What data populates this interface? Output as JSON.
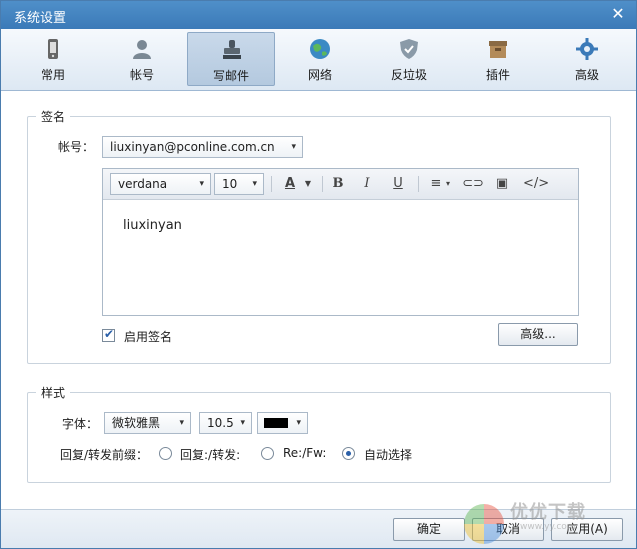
{
  "window": {
    "title": "系统设置"
  },
  "tabs": [
    {
      "label": "常用",
      "icon": "phone-icon"
    },
    {
      "label": "帐号",
      "icon": "user-icon"
    },
    {
      "label": "写邮件",
      "icon": "stamp-icon",
      "active": true
    },
    {
      "label": "网络",
      "icon": "globe-icon"
    },
    {
      "label": "反垃圾",
      "icon": "shield-icon"
    },
    {
      "label": "插件",
      "icon": "box-icon"
    },
    {
      "label": "高级",
      "icon": "gear-icon"
    }
  ],
  "signature": {
    "group_title": "签名",
    "account_label": "帐号：",
    "account_value": "liuxinyan@pconline.com.cn",
    "font_value": "verdana",
    "size_value": "10",
    "editor_text": "liuxinyan",
    "enable_label": "启用签名",
    "enable_checked": true,
    "advanced_button": "高级..."
  },
  "style": {
    "group_title": "样式",
    "font_label": "字体：",
    "font_value": "微软雅黑",
    "size_value": "10.5",
    "color_value": "#000000",
    "prefix_label": "回复/转发前缀：",
    "options": [
      {
        "label": "回复:/转发:",
        "checked": false
      },
      {
        "label": "Re:/Fw:",
        "checked": false
      },
      {
        "label": "自动选择",
        "checked": true
      }
    ]
  },
  "footer": {
    "ok": "确定",
    "cancel": "取消",
    "apply": "应用(A)"
  },
  "watermark": {
    "text": "优优下载",
    "sub": "www.yy.com"
  },
  "colors": {
    "accent": "#3b7ab8",
    "checked": "#2a5fa8"
  }
}
